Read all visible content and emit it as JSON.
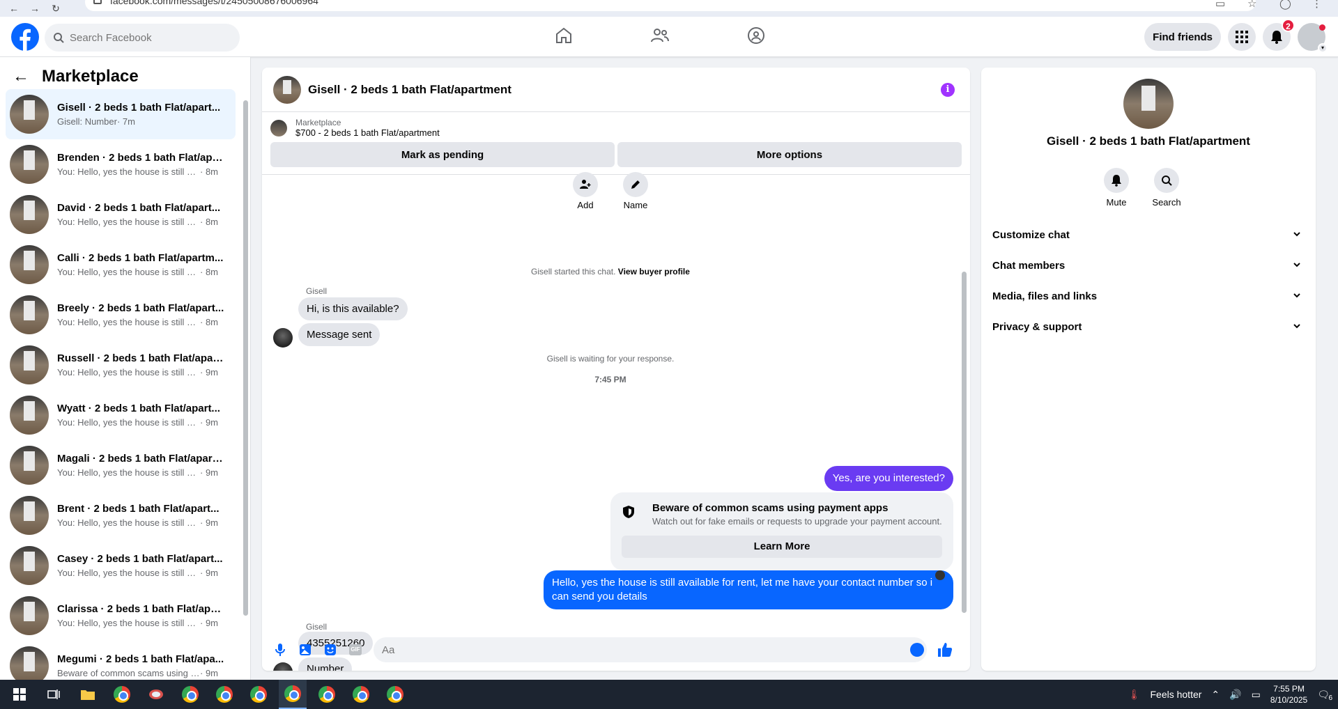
{
  "browser": {
    "url": "facebook.com/messages/t/24505008676006964"
  },
  "header": {
    "search_placeholder": "Search Facebook",
    "find_friends": "Find friends",
    "notifications_count": "2"
  },
  "sidebar": {
    "title": "Marketplace",
    "conversations": [
      {
        "name": "Gisell · 2 beds 1 bath Flat/apart...",
        "preview": "Gisell: Number",
        "time": "· 7m",
        "active": true
      },
      {
        "name": "Brenden · 2 beds 1 bath Flat/apa...",
        "preview": "You: Hello, yes the house is still av...",
        "time": "· 8m"
      },
      {
        "name": "David · 2 beds 1 bath Flat/apart...",
        "preview": "You: Hello, yes the house is still av...",
        "time": "· 8m"
      },
      {
        "name": "Calli · 2 beds 1 bath Flat/apartm...",
        "preview": "You: Hello, yes the house is still av...",
        "time": "· 8m"
      },
      {
        "name": "Breely · 2 beds 1 bath Flat/apart...",
        "preview": "You: Hello, yes the house is still av...",
        "time": "· 8m"
      },
      {
        "name": "Russell · 2 beds 1 bath Flat/apart...",
        "preview": "You: Hello, yes the house is still av...",
        "time": "· 9m"
      },
      {
        "name": "Wyatt · 2 beds 1 bath Flat/apart...",
        "preview": "You: Hello, yes the house is still av...",
        "time": "· 9m"
      },
      {
        "name": "Magali · 2 beds 1 bath Flat/apart...",
        "preview": "You: Hello, yes the house is still av...",
        "time": "· 9m"
      },
      {
        "name": "Brent · 2 beds 1 bath Flat/apart...",
        "preview": "You: Hello, yes the house is still av...",
        "time": "· 9m"
      },
      {
        "name": "Casey · 2 beds 1 bath Flat/apart...",
        "preview": "You: Hello, yes the house is still av...",
        "time": "· 9m"
      },
      {
        "name": "Clarissa · 2 beds 1 bath Flat/apar...",
        "preview": "You: Hello, yes the house is still av...",
        "time": "· 9m"
      },
      {
        "name": "Megumi · 2 beds 1 bath Flat/apa...",
        "preview": "Beware of common scams using p...",
        "time": "· 9m"
      }
    ]
  },
  "chat": {
    "title": "Gisell · 2 beds 1 bath Flat/apartment",
    "listing_label": "Marketplace",
    "listing_price": "$700 - 2 beds 1 bath Flat/apartment",
    "mark_pending": "Mark as pending",
    "more_options": "More options",
    "quick_add": "Add",
    "quick_name": "Name",
    "started_text": "Gisell started this chat.",
    "view_buyer": "View buyer profile",
    "sender": "Gisell",
    "msg1": "Hi, is this available?",
    "msg2": "Message sent",
    "waiting_text": "Gisell is waiting for your response.",
    "timestamp": "7:45 PM",
    "out1": "Yes, are you interested?",
    "scam_title": "Beware of common scams using payment apps",
    "scam_desc": "Watch out for fake emails or requests to upgrade your payment account.",
    "learn_more": "Learn More",
    "out2": "Hello, yes the house is still available for rent, let me have your contact number so i can send you details",
    "sender2": "Gisell",
    "msg3": "4355251260",
    "msg4": "Number",
    "composer_placeholder": "Aa",
    "gif_label": "GIF"
  },
  "info_panel": {
    "title": "Gisell · 2 beds 1 bath Flat/apartment",
    "mute": "Mute",
    "search": "Search",
    "sections": [
      "Customize chat",
      "Chat members",
      "Media, files and links",
      "Privacy & support"
    ]
  },
  "taskbar": {
    "weather": "Feels hotter",
    "time": "7:55 PM",
    "date": "8/10/2025",
    "notif_count": "6"
  },
  "colors": {
    "brand": "#0866ff",
    "outgoing_purple": "#6a3bf2",
    "info": "#a033ff",
    "badge": "#e41e3f"
  }
}
